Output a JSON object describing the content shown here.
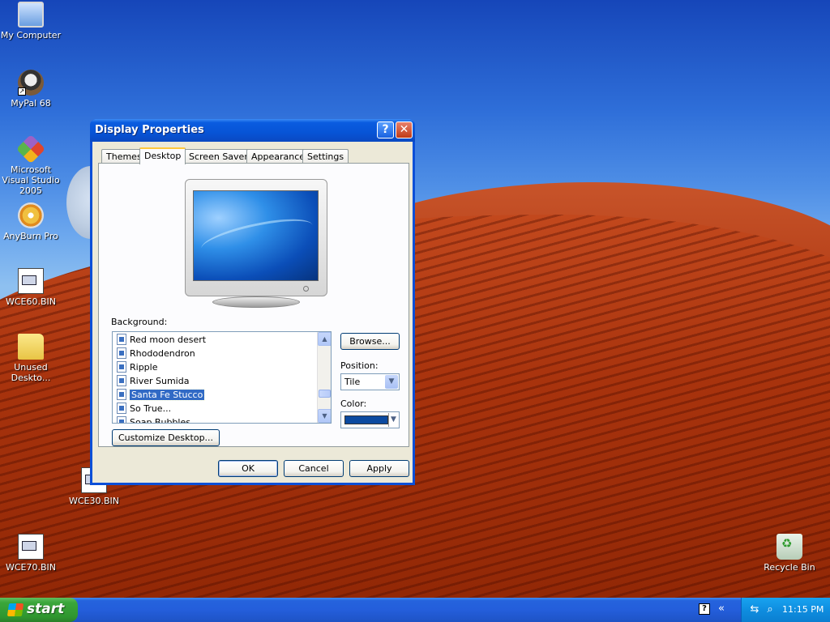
{
  "desktop": {
    "icons": [
      {
        "label": "My Computer",
        "icon": "computer-icon"
      },
      {
        "label": "MyPal 68",
        "icon": "mypal-icon"
      },
      {
        "label": "Microsoft Visual Studio 2005",
        "icon": "visual-studio-icon"
      },
      {
        "label": "AnyBurn Pro",
        "icon": "anyburn-icon"
      },
      {
        "label": "WCE60.BIN",
        "icon": "bin-file-icon"
      },
      {
        "label": "Unused Deskto...",
        "icon": "folder-icon"
      },
      {
        "label": "WCE30.BIN",
        "icon": "bin-file-icon"
      },
      {
        "label": "WCE70.BIN",
        "icon": "bin-file-icon"
      },
      {
        "label": "Recycle Bin",
        "icon": "recycle-bin-icon"
      }
    ]
  },
  "window": {
    "title": "Display Properties",
    "help_glyph": "?",
    "close_glyph": "✕",
    "tabs": [
      "Themes",
      "Desktop",
      "Screen Saver",
      "Appearance",
      "Settings"
    ],
    "active_tab": "Desktop",
    "background_label": "Background:",
    "background_items": [
      "Red moon desert",
      "Rhododendron",
      "Ripple",
      "River Sumida",
      "Santa Fe Stucco",
      "So True...",
      "Soap Bubbles"
    ],
    "selected_background": "Santa Fe Stucco",
    "browse_label": "Browse...",
    "position_label": "Position:",
    "position_value": "Tile",
    "color_label": "Color:",
    "color_value": "#0b4aa0",
    "customize_label": "Customize Desktop...",
    "ok_label": "OK",
    "cancel_label": "Cancel",
    "apply_label": "Apply"
  },
  "taskbar": {
    "start_label": "start",
    "clock": "11:15 PM",
    "tray_help_glyph": "?",
    "tray_expand_glyph": "«"
  },
  "colors": {
    "title_bar": "#0754d6",
    "start_button": "#3aa63a",
    "selection": "#316ac5"
  }
}
